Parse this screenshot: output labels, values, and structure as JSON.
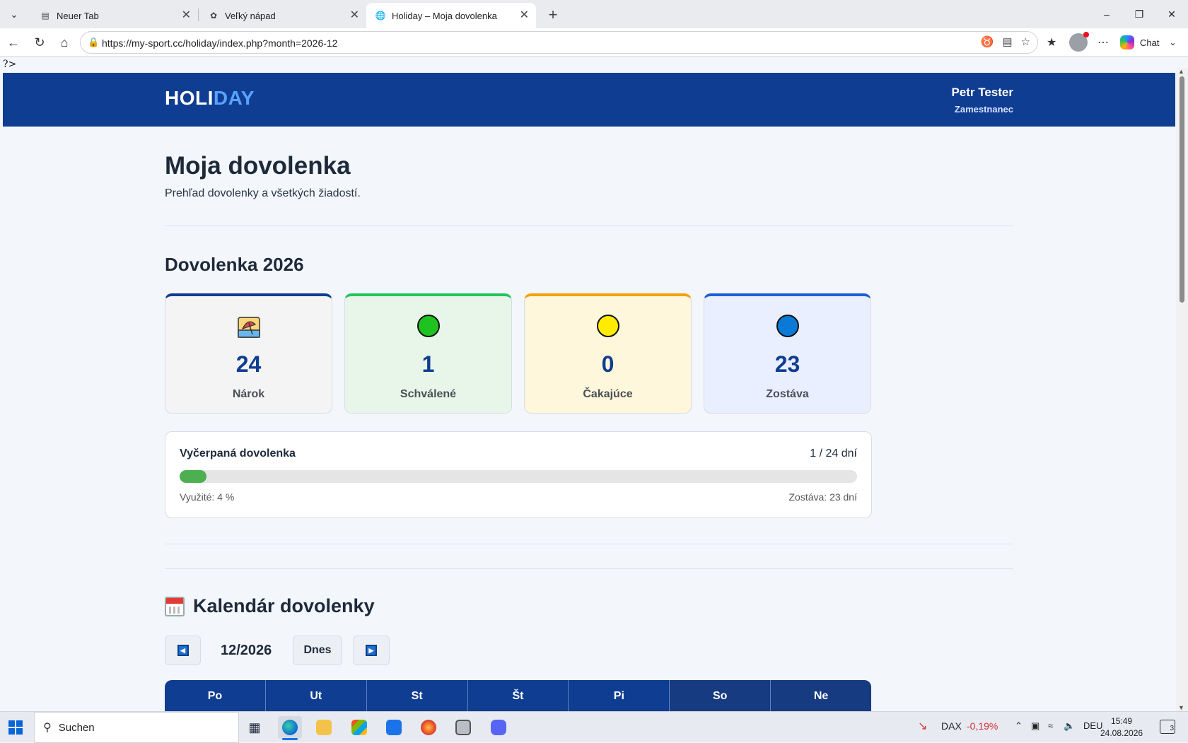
{
  "browser": {
    "tabs": [
      {
        "title": "Neuer Tab",
        "icon": "page-icon"
      },
      {
        "title": "Veľký nápad",
        "icon": "chatgpt-icon"
      },
      {
        "title": "Holiday – Moja dovolenka",
        "icon": "globe-icon",
        "active": true
      }
    ],
    "url": "https://my-sport.cc/holiday/index.php?month=2026-12",
    "chat_label": "Chat"
  },
  "page": {
    "stray_text": "?>",
    "logo_part1": "HOLI",
    "logo_part2": "DAY",
    "user_name": "Petr Tester",
    "user_role": "Zamestnanec",
    "title": "Moja dovolenka",
    "subtitle": "Prehľad dovolenky a všetkých žiadostí.",
    "section_title": "Dovolenka 2026",
    "cards": [
      {
        "value": "24",
        "label": "Nárok",
        "icon": "beach-umbrella-icon",
        "bg": "#f4f4f5",
        "border": "#0f3d91"
      },
      {
        "value": "1",
        "label": "Schválené",
        "icon": "green-circle-icon",
        "bg": "#e8f6ea",
        "border": "#22c55e",
        "dot": "#1fc31f"
      },
      {
        "value": "0",
        "label": "Čakajúce",
        "icon": "yellow-circle-icon",
        "bg": "#fff7dc",
        "border": "#f2a20c",
        "dot": "#ffec00"
      },
      {
        "value": "23",
        "label": "Zostáva",
        "icon": "blue-circle-icon",
        "bg": "#e9efff",
        "border": "#1f5fd6",
        "dot": "#0a7ad6"
      }
    ],
    "progress": {
      "title": "Vyčerpaná dovolenka",
      "count": "1 / 24 dní",
      "percent": 4,
      "used_label": "Využité: 4 %",
      "remaining_label": "Zostáva: 23 dní"
    },
    "calendar": {
      "title": "Kalendár dovolenky",
      "month": "12/2026",
      "today_label": "Dnes",
      "days": [
        "Po",
        "Ut",
        "St",
        "Št",
        "Pi",
        "So",
        "Ne"
      ]
    }
  },
  "taskbar": {
    "search_text": "Suchen",
    "dax_label": "DAX",
    "dax_value": "-0,19%",
    "lang": "DEU",
    "time": "15:49",
    "date": "24.08.2026",
    "notifications": "3"
  }
}
